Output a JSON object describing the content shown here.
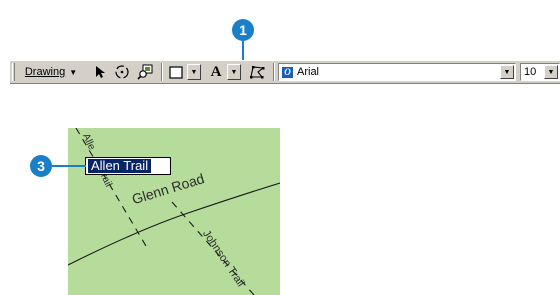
{
  "toolbar": {
    "drawing_label": "Drawing",
    "font_value": "Arial",
    "size_value": "10",
    "text_tool_glyph": "A"
  },
  "icons": {
    "drawing_caret": "down-caret-icon",
    "select_tool": "arrow-pointer-icon",
    "rotate_tool": "rotate-icon",
    "zoom_to_selected": "zoom-selected-icon",
    "rectangle_tool": "rectangle-icon",
    "text_tool": "text-icon",
    "edit_vertices": "edit-vertices-icon",
    "font_icon": "font-icon"
  },
  "callouts": {
    "one": "1",
    "three": "3"
  },
  "map": {
    "labels": {
      "glenn_road": "Glenn Road",
      "johnson_trail": "Johnson Trail",
      "allen_trail_partial_top": "Alle",
      "allen_trail_partial_bottom": "rail"
    },
    "edit_text": "Allen Trail"
  },
  "colors": {
    "callout": "#1a7fc9",
    "map_background": "#b6dc9c",
    "selection": "#0a246a",
    "toolbar": "#d4d0c8"
  }
}
